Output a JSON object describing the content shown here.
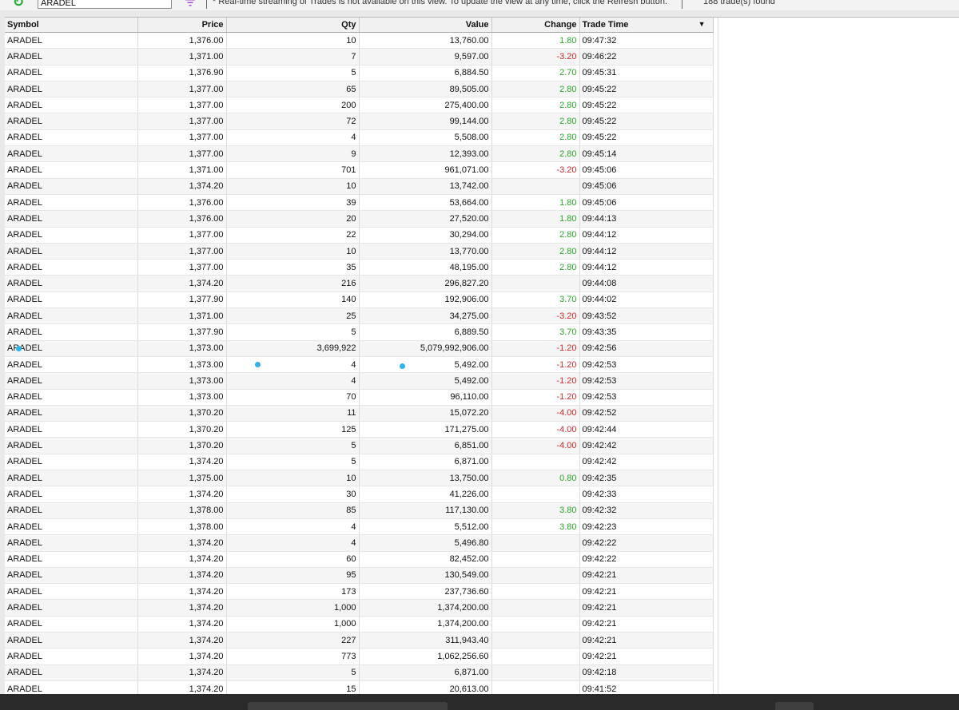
{
  "toolbar": {
    "search_value": "ARADEL",
    "notice": "* Real-time streaming of Trades is not available on this view. To update the view at any time, click the Refresh button.",
    "trade_count": "188 trade(s) found"
  },
  "columns": {
    "symbol": "Symbol",
    "price": "Price",
    "qty": "Qty",
    "value": "Value",
    "change": "Change",
    "time": "Trade Time"
  },
  "rows": [
    {
      "symbol": "ARADEL",
      "price": "1,376.00",
      "qty": "10",
      "value": "13,760.00",
      "change": "1.80",
      "time": "09:47:32",
      "dir": "up"
    },
    {
      "symbol": "ARADEL",
      "price": "1,371.00",
      "qty": "7",
      "value": "9,597.00",
      "change": "-3.20",
      "time": "09:46:22",
      "dir": "down"
    },
    {
      "symbol": "ARADEL",
      "price": "1,376.90",
      "qty": "5",
      "value": "6,884.50",
      "change": "2.70",
      "time": "09:45:31",
      "dir": "up"
    },
    {
      "symbol": "ARADEL",
      "price": "1,377.00",
      "qty": "65",
      "value": "89,505.00",
      "change": "2.80",
      "time": "09:45:22",
      "dir": "up"
    },
    {
      "symbol": "ARADEL",
      "price": "1,377.00",
      "qty": "200",
      "value": "275,400.00",
      "change": "2.80",
      "time": "09:45:22",
      "dir": "up"
    },
    {
      "symbol": "ARADEL",
      "price": "1,377.00",
      "qty": "72",
      "value": "99,144.00",
      "change": "2.80",
      "time": "09:45:22",
      "dir": "up"
    },
    {
      "symbol": "ARADEL",
      "price": "1,377.00",
      "qty": "4",
      "value": "5,508.00",
      "change": "2.80",
      "time": "09:45:22",
      "dir": "up"
    },
    {
      "symbol": "ARADEL",
      "price": "1,377.00",
      "qty": "9",
      "value": "12,393.00",
      "change": "2.80",
      "time": "09:45:14",
      "dir": "up"
    },
    {
      "symbol": "ARADEL",
      "price": "1,371.00",
      "qty": "701",
      "value": "961,071.00",
      "change": "-3.20",
      "time": "09:45:06",
      "dir": "down"
    },
    {
      "symbol": "ARADEL",
      "price": "1,374.20",
      "qty": "10",
      "value": "13,742.00",
      "change": "",
      "time": "09:45:06",
      "dir": "none"
    },
    {
      "symbol": "ARADEL",
      "price": "1,376.00",
      "qty": "39",
      "value": "53,664.00",
      "change": "1.80",
      "time": "09:45:06",
      "dir": "up"
    },
    {
      "symbol": "ARADEL",
      "price": "1,376.00",
      "qty": "20",
      "value": "27,520.00",
      "change": "1.80",
      "time": "09:44:13",
      "dir": "up"
    },
    {
      "symbol": "ARADEL",
      "price": "1,377.00",
      "qty": "22",
      "value": "30,294.00",
      "change": "2.80",
      "time": "09:44:12",
      "dir": "up"
    },
    {
      "symbol": "ARADEL",
      "price": "1,377.00",
      "qty": "10",
      "value": "13,770.00",
      "change": "2.80",
      "time": "09:44:12",
      "dir": "up"
    },
    {
      "symbol": "ARADEL",
      "price": "1,377.00",
      "qty": "35",
      "value": "48,195.00",
      "change": "2.80",
      "time": "09:44:12",
      "dir": "up"
    },
    {
      "symbol": "ARADEL",
      "price": "1,374.20",
      "qty": "216",
      "value": "296,827.20",
      "change": "",
      "time": "09:44:08",
      "dir": "none"
    },
    {
      "symbol": "ARADEL",
      "price": "1,377.90",
      "qty": "140",
      "value": "192,906.00",
      "change": "3.70",
      "time": "09:44:02",
      "dir": "up"
    },
    {
      "symbol": "ARADEL",
      "price": "1,371.00",
      "qty": "25",
      "value": "34,275.00",
      "change": "-3.20",
      "time": "09:43:52",
      "dir": "down"
    },
    {
      "symbol": "ARADEL",
      "price": "1,377.90",
      "qty": "5",
      "value": "6,889.50",
      "change": "3.70",
      "time": "09:43:35",
      "dir": "up"
    },
    {
      "symbol": "ARADEL",
      "price": "1,373.00",
      "qty": "3,699,922",
      "value": "5,079,992,906.00",
      "change": "-1.20",
      "time": "09:42:56",
      "dir": "down"
    },
    {
      "symbol": "ARADEL",
      "price": "1,373.00",
      "qty": "4",
      "value": "5,492.00",
      "change": "-1.20",
      "time": "09:42:53",
      "dir": "down"
    },
    {
      "symbol": "ARADEL",
      "price": "1,373.00",
      "qty": "4",
      "value": "5,492.00",
      "change": "-1.20",
      "time": "09:42:53",
      "dir": "down"
    },
    {
      "symbol": "ARADEL",
      "price": "1,373.00",
      "qty": "70",
      "value": "96,110.00",
      "change": "-1.20",
      "time": "09:42:53",
      "dir": "down"
    },
    {
      "symbol": "ARADEL",
      "price": "1,370.20",
      "qty": "11",
      "value": "15,072.20",
      "change": "-4.00",
      "time": "09:42:52",
      "dir": "down"
    },
    {
      "symbol": "ARADEL",
      "price": "1,370.20",
      "qty": "125",
      "value": "171,275.00",
      "change": "-4.00",
      "time": "09:42:44",
      "dir": "down"
    },
    {
      "symbol": "ARADEL",
      "price": "1,370.20",
      "qty": "5",
      "value": "6,851.00",
      "change": "-4.00",
      "time": "09:42:42",
      "dir": "down"
    },
    {
      "symbol": "ARADEL",
      "price": "1,374.20",
      "qty": "5",
      "value": "6,871.00",
      "change": "",
      "time": "09:42:42",
      "dir": "none"
    },
    {
      "symbol": "ARADEL",
      "price": "1,375.00",
      "qty": "10",
      "value": "13,750.00",
      "change": "0.80",
      "time": "09:42:35",
      "dir": "up"
    },
    {
      "symbol": "ARADEL",
      "price": "1,374.20",
      "qty": "30",
      "value": "41,226.00",
      "change": "",
      "time": "09:42:33",
      "dir": "none"
    },
    {
      "symbol": "ARADEL",
      "price": "1,378.00",
      "qty": "85",
      "value": "117,130.00",
      "change": "3.80",
      "time": "09:42:32",
      "dir": "up"
    },
    {
      "symbol": "ARADEL",
      "price": "1,378.00",
      "qty": "4",
      "value": "5,512.00",
      "change": "3.80",
      "time": "09:42:23",
      "dir": "up"
    },
    {
      "symbol": "ARADEL",
      "price": "1,374.20",
      "qty": "4",
      "value": "5,496.80",
      "change": "",
      "time": "09:42:22",
      "dir": "none"
    },
    {
      "symbol": "ARADEL",
      "price": "1,374.20",
      "qty": "60",
      "value": "82,452.00",
      "change": "",
      "time": "09:42:22",
      "dir": "none"
    },
    {
      "symbol": "ARADEL",
      "price": "1,374.20",
      "qty": "95",
      "value": "130,549.00",
      "change": "",
      "time": "09:42:21",
      "dir": "none"
    },
    {
      "symbol": "ARADEL",
      "price": "1,374.20",
      "qty": "173",
      "value": "237,736.60",
      "change": "",
      "time": "09:42:21",
      "dir": "none"
    },
    {
      "symbol": "ARADEL",
      "price": "1,374.20",
      "qty": "1,000",
      "value": "1,374,200.00",
      "change": "",
      "time": "09:42:21",
      "dir": "none"
    },
    {
      "symbol": "ARADEL",
      "price": "1,374.20",
      "qty": "1,000",
      "value": "1,374,200.00",
      "change": "",
      "time": "09:42:21",
      "dir": "none"
    },
    {
      "symbol": "ARADEL",
      "price": "1,374.20",
      "qty": "227",
      "value": "311,943.40",
      "change": "",
      "time": "09:42:21",
      "dir": "none"
    },
    {
      "symbol": "ARADEL",
      "price": "1,374.20",
      "qty": "773",
      "value": "1,062,256.60",
      "change": "",
      "time": "09:42:21",
      "dir": "none"
    },
    {
      "symbol": "ARADEL",
      "price": "1,374.20",
      "qty": "5",
      "value": "6,871.00",
      "change": "",
      "time": "09:42:18",
      "dir": "none"
    },
    {
      "symbol": "ARADEL",
      "price": "1,374.20",
      "qty": "15",
      "value": "20,613.00",
      "change": "",
      "time": "09:41:52",
      "dir": "none"
    }
  ],
  "colors": {
    "positive": "#2ca52c",
    "negative": "#d22a2a",
    "accent": "#22aa33"
  },
  "icons": {
    "refresh": "refresh-icon",
    "filter": "filter-icon",
    "sort": "sort-desc-icon"
  }
}
